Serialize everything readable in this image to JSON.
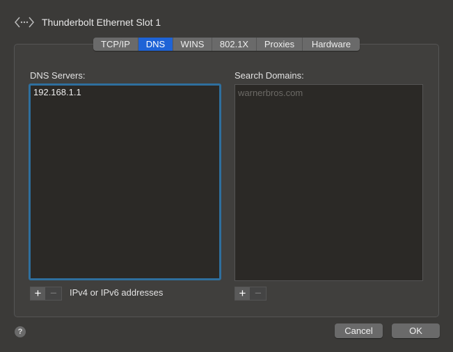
{
  "window": {
    "title": "Thunderbolt Ethernet Slot 1",
    "icon": "network-interface-icon"
  },
  "tabs": [
    {
      "label": "TCP/IP",
      "active": false
    },
    {
      "label": "DNS",
      "active": true
    },
    {
      "label": "WINS",
      "active": false
    },
    {
      "label": "802.1X",
      "active": false
    },
    {
      "label": "Proxies",
      "active": false
    },
    {
      "label": "Hardware",
      "active": false
    }
  ],
  "dns": {
    "label": "DNS Servers:",
    "servers": [
      "192.168.1.1"
    ],
    "hint": "IPv4 or IPv6 addresses"
  },
  "search": {
    "label": "Search Domains:",
    "placeholder": "warnerbros.com"
  },
  "controls": {
    "add": "+",
    "remove": "−"
  },
  "footer": {
    "help": "?",
    "cancel": "Cancel",
    "ok": "OK"
  },
  "colors": {
    "accent": "#1e63d6",
    "focus_ring": "#2f6f9e"
  }
}
